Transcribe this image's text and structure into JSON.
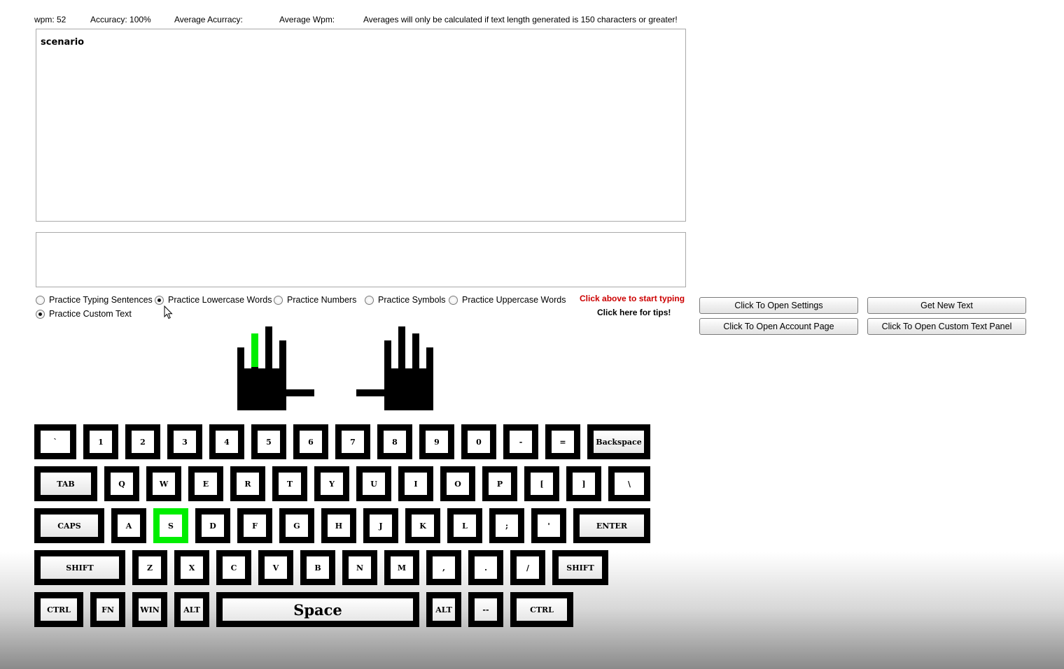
{
  "stats": {
    "wpm": "wpm: 52",
    "accuracy": "Accuracy: 100%",
    "avg_accuracy": "Average Acurracy:",
    "avg_wpm": "Average Wpm:",
    "note": "Averages will only be calculated if text length generated is 150 characters or greater!"
  },
  "display_text": "scenario",
  "input_value": "",
  "practice_options": [
    {
      "label": "Practice Typing Sentences",
      "checked": false
    },
    {
      "label": "Practice Lowercase Words",
      "checked": true
    },
    {
      "label": "Practice Numbers",
      "checked": false
    },
    {
      "label": "Practice Symbols",
      "checked": false
    },
    {
      "label": "Practice Uppercase Words",
      "checked": false
    },
    {
      "label": "Practice Custom Text",
      "checked": true
    }
  ],
  "start_hint": "Click above to start typing",
  "tips_link": "Click here for tips!",
  "buttons": {
    "open_settings": "Click To Open Settings",
    "new_text": "Get New Text",
    "account_page": "Click To Open Account Page",
    "custom_text_panel": "Click To Open Custom Text Panel"
  },
  "hands": {
    "highlighted_finger": "left-middle",
    "highlight_color": "#00ee00"
  },
  "keyboard": {
    "active_key": "S",
    "active_color": "#00ee00",
    "rows": [
      [
        "`",
        "1",
        "2",
        "3",
        "4",
        "5",
        "6",
        "7",
        "8",
        "9",
        "0",
        "-",
        "=",
        "Backspace"
      ],
      [
        "TAB",
        "Q",
        "W",
        "E",
        "R",
        "T",
        "Y",
        "U",
        "I",
        "O",
        "P",
        "[",
        "]",
        "\\"
      ],
      [
        "CAPS",
        "A",
        "S",
        "D",
        "F",
        "G",
        "H",
        "J",
        "K",
        "L",
        ";",
        "'",
        "ENTER"
      ],
      [
        "SHIFT",
        "Z",
        "X",
        "C",
        "V",
        "B",
        "N",
        "M",
        ",",
        ".",
        "/",
        "SHIFT"
      ],
      [
        "CTRL",
        "FN",
        "WIN",
        "ALT",
        "Space",
        "ALT",
        "--",
        "CTRL"
      ]
    ]
  }
}
